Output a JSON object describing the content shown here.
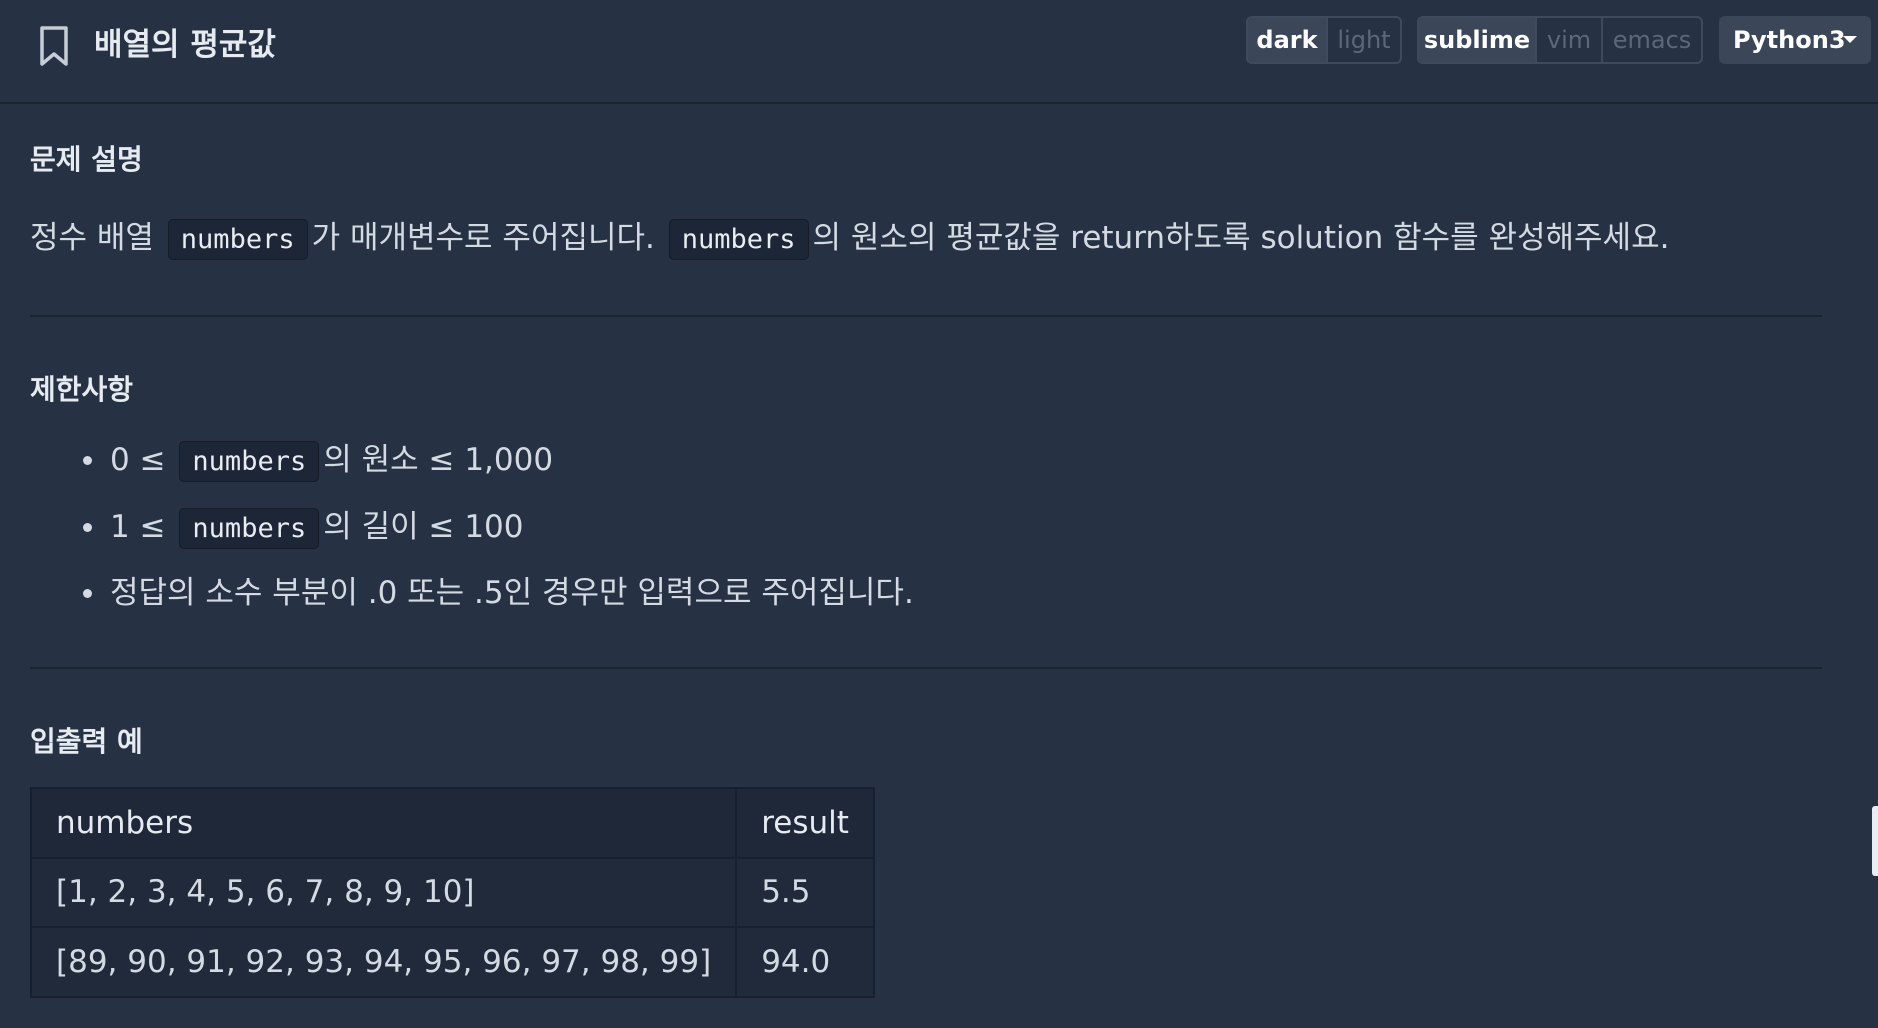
{
  "header": {
    "title": "배열의 평균값",
    "theme_toggle": {
      "options": [
        "dark",
        "light"
      ],
      "selected": "dark"
    },
    "editor_toggle": {
      "options": [
        "sublime",
        "vim",
        "emacs"
      ],
      "selected": "sublime"
    },
    "language": "Python3"
  },
  "description": {
    "heading": "문제 설명",
    "text_1": "정수 배열",
    "code_1": "numbers",
    "text_2": "가 매개변수로 주어집니다.",
    "code_2": "numbers",
    "text_3": "의 원소의 평균값을 return하도록 solution 함수를 완성해주세요."
  },
  "constraints": {
    "heading": "제한사항",
    "items": [
      {
        "before": "0 ≤",
        "code": "numbers",
        "after": "의 원소 ≤ 1,000"
      },
      {
        "before": "1 ≤",
        "code": "numbers",
        "after": "의 길이 ≤ 100"
      },
      {
        "before": "정답의 소수 부분이 .0 또는 .5인 경우만 입력으로 주어집니다.",
        "code": "",
        "after": ""
      }
    ]
  },
  "examples": {
    "heading": "입출력 예",
    "columns": [
      "numbers",
      "result"
    ],
    "rows": [
      [
        "[1, 2, 3, 4, 5, 6, 7, 8, 9, 10]",
        "5.5"
      ],
      [
        "[89, 90, 91, 92, 93, 94, 95, 96, 97, 98, 99]",
        "94.0"
      ]
    ]
  }
}
